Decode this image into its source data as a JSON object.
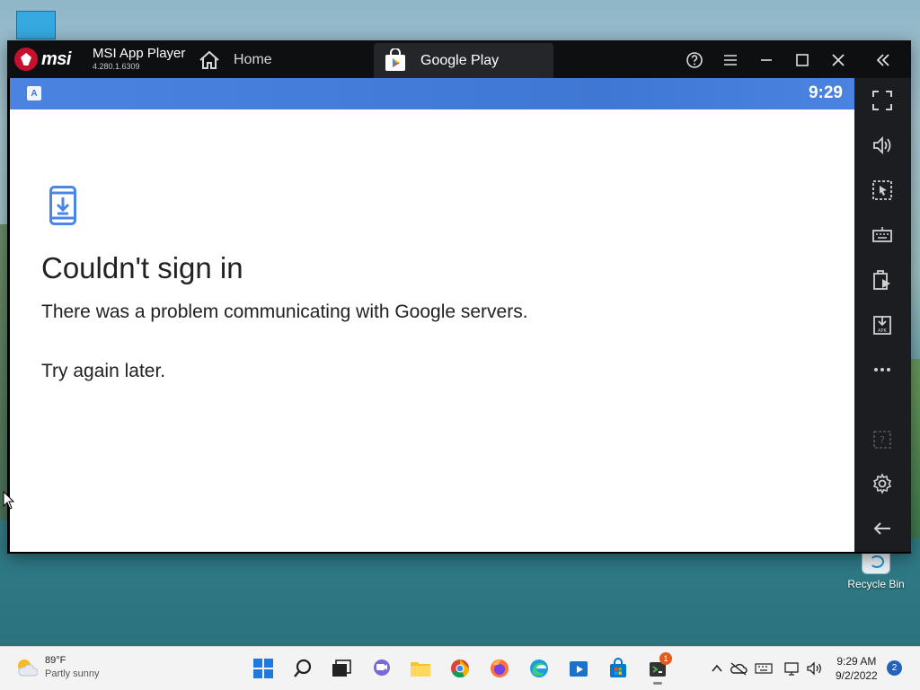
{
  "window": {
    "brand": "msi",
    "app_title": "MSI App Player",
    "version": "4.280.1.6309",
    "home_label": "Home",
    "tab_label": "Google Play"
  },
  "android": {
    "status_time": "9:29",
    "status_icon_letter": "A",
    "error_title": "Couldn't sign in",
    "error_message": "There was a problem communicating with Google servers.",
    "error_retry": "Try again later."
  },
  "sidebar": {
    "items": [
      "fullscreen-icon",
      "volume-icon",
      "screenshot-icon",
      "keyboard-icon",
      "multi-instance-icon",
      "apk-install-icon",
      "more-icon",
      "help-icon",
      "settings-icon",
      "back-icon"
    ]
  },
  "desktop": {
    "recycle_bin_label": "Recycle Bin"
  },
  "taskbar": {
    "weather_temp": "89°F",
    "weather_desc": "Partly sunny",
    "clock_time": "9:29 AM",
    "clock_date": "9/2/2022",
    "notification_count": "2",
    "app_badge_count": "1"
  },
  "colors": {
    "statusbar_blue": "#3f78d4",
    "titlebar_bg": "#0e0f11",
    "sidebar_bg": "#1c1d21",
    "msi_red": "#c8102e",
    "icon_blue": "#4a86e8"
  }
}
